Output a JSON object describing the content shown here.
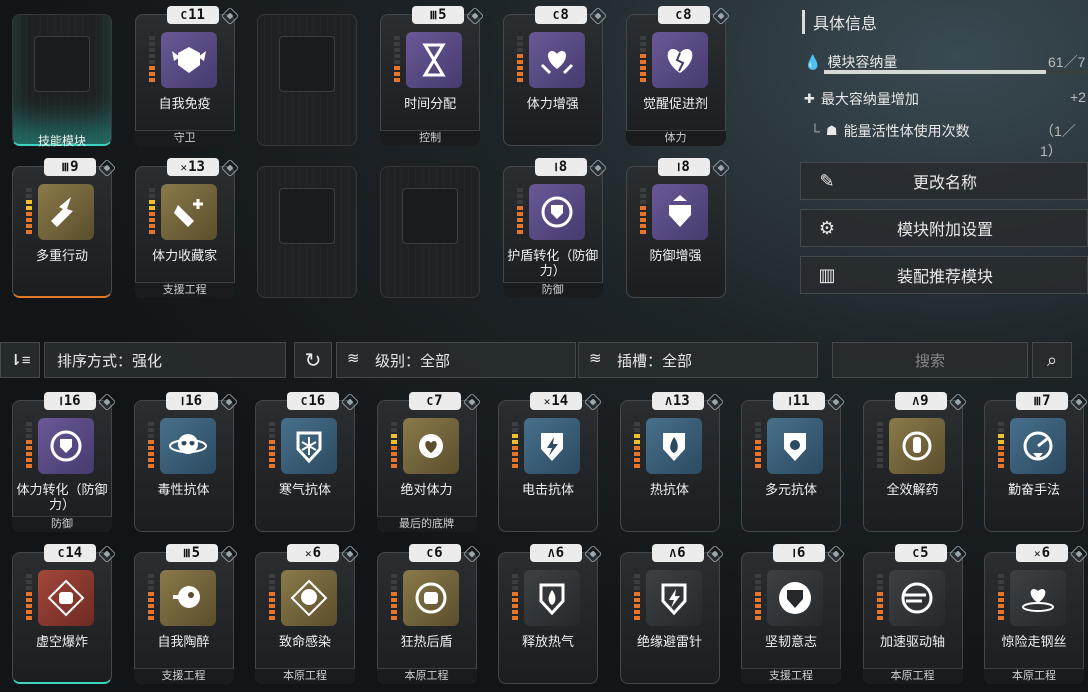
{
  "slots": [
    {
      "key": "s0",
      "tag": "",
      "name": "技能模块",
      "sub": "",
      "empty": true,
      "glow": "teal"
    },
    {
      "key": "s1",
      "tag": "11",
      "tagicon": "C",
      "name": "自我免疫",
      "sub": "守卫",
      "color": "c-purple",
      "bars": 3,
      "icon": "wings-shield-icon"
    },
    {
      "key": "s2",
      "empty": true
    },
    {
      "key": "s3",
      "tag": "5",
      "tagicon": "W",
      "name": "时间分配",
      "sub": "控制",
      "color": "c-purple",
      "bars": 3,
      "icon": "hourglass-icon"
    },
    {
      "key": "s4",
      "tag": "8",
      "tagicon": "C",
      "name": "体力增强",
      "sub": "",
      "color": "c-purple",
      "bars": 5,
      "icon": "heart-hands-icon"
    },
    {
      "key": "s5",
      "tag": "8",
      "tagicon": "C",
      "name": "觉醒促进剂",
      "sub": "体力",
      "color": "c-purple",
      "bars": 5,
      "icon": "broken-heart-icon"
    },
    {
      "key": "s6",
      "tag": "9",
      "tagicon": "W",
      "name": "多重行动",
      "sub": "",
      "color": "c-gold",
      "bars": 6,
      "yellow": true,
      "icon": "lightning-runner-icon",
      "glow": "orange"
    },
    {
      "key": "s7",
      "tag": "13",
      "tagicon": "X",
      "name": "体力收藏家",
      "sub": "支援工程",
      "color": "c-gold",
      "bars": 6,
      "yellow": true,
      "icon": "hand-plus-icon"
    },
    {
      "key": "s8",
      "empty": true
    },
    {
      "key": "s9",
      "empty": true
    },
    {
      "key": "s10",
      "tag": "8",
      "tagicon": "I",
      "name": "护盾转化（防御力）",
      "sub": "防御",
      "color": "c-purple",
      "bars": 5,
      "icon": "shield-cycle-icon"
    },
    {
      "key": "s11",
      "tag": "8",
      "tagicon": "I",
      "name": "防御增强",
      "sub": "",
      "color": "c-purple",
      "bars": 5,
      "icon": "shield-up-icon"
    }
  ],
  "panel": {
    "title": "具体信息",
    "capacity_label": "模块容纳量",
    "capacity_value": "61／7",
    "capacity_fraction": 0.84,
    "max_label": "最大容纳量增加",
    "max_value": "+2",
    "energy_label": "能量活性体使用次数",
    "energy_value": "（1／1）",
    "btn_rename": "更改名称",
    "btn_extra": "模块附加设置",
    "btn_recommend": "装配推荐模块"
  },
  "filters": {
    "sort": "排序方式：强化",
    "level": "级别：全部",
    "slot": "插槽：全部",
    "search_placeholder": "搜索"
  },
  "inventory": [
    {
      "tag": "16",
      "tagicon": "I",
      "name": "体力转化（防御力）",
      "sub": "防御",
      "color": "c-purple",
      "bars": 5,
      "icon": "shield-cycle-icon"
    },
    {
      "tag": "16",
      "tagicon": "I",
      "name": "毒性抗体",
      "sub": "",
      "color": "c-blue",
      "bars": 5,
      "icon": "toxic-skull-icon"
    },
    {
      "tag": "16",
      "tagicon": "C",
      "name": "寒气抗体",
      "sub": "",
      "color": "c-blue",
      "bars": 5,
      "icon": "snowflake-shield-icon"
    },
    {
      "tag": "7",
      "tagicon": "C",
      "name": "绝对体力",
      "sub": "最后的底牌",
      "color": "c-gold",
      "bars": 6,
      "yellow": true,
      "icon": "sun-heart-icon"
    },
    {
      "tag": "14",
      "tagicon": "X",
      "name": "电击抗体",
      "sub": "",
      "color": "c-blue",
      "bars": 6,
      "yellow": true,
      "icon": "bolt-shield-icon"
    },
    {
      "tag": "13",
      "tagicon": "A",
      "name": "热抗体",
      "sub": "",
      "color": "c-blue",
      "bars": 6,
      "yellow": true,
      "icon": "fire-shield-icon"
    },
    {
      "tag": "11",
      "tagicon": "I",
      "name": "多元抗体",
      "sub": "",
      "color": "c-blue",
      "bars": 5,
      "icon": "multi-shield-icon"
    },
    {
      "tag": "9",
      "tagicon": "A",
      "name": "全效解药",
      "sub": "",
      "color": "c-gold",
      "bars": 0,
      "icon": "antidote-icon"
    },
    {
      "tag": "7",
      "tagicon": "W",
      "name": "勤奋手法",
      "sub": "",
      "color": "c-blue",
      "bars": 6,
      "yellow": true,
      "icon": "gauge-icon"
    },
    {
      "tag": "14",
      "tagicon": "C",
      "name": "虚空爆炸",
      "sub": "",
      "color": "c-red",
      "bars": 5,
      "icon": "fist-burst-icon",
      "glow": "teal"
    },
    {
      "tag": "5",
      "tagicon": "W",
      "name": "自我陶醉",
      "sub": "支援工程",
      "color": "c-gold",
      "bars": 5,
      "icon": "head-gun-icon"
    },
    {
      "tag": "6",
      "tagicon": "X",
      "name": "致命感染",
      "sub": "本原工程",
      "color": "c-gold",
      "bars": 5,
      "icon": "skull-burst-icon"
    },
    {
      "tag": "6",
      "tagicon": "C",
      "name": "狂热后盾",
      "sub": "本原工程",
      "color": "c-gold",
      "bars": 5,
      "icon": "fist-circle-icon"
    },
    {
      "tag": "6",
      "tagicon": "A",
      "name": "释放热气",
      "sub": "",
      "color": "c-dark",
      "bars": 5,
      "icon": "fire-emblem-icon"
    },
    {
      "tag": "6",
      "tagicon": "A",
      "name": "绝缘避雷针",
      "sub": "",
      "color": "c-dark",
      "bars": 5,
      "icon": "bolt-emblem-icon"
    },
    {
      "tag": "6",
      "tagicon": "I",
      "name": "坚韧意志",
      "sub": "支援工程",
      "color": "c-dark",
      "bars": 5,
      "icon": "shield-emblem-icon"
    },
    {
      "tag": "5",
      "tagicon": "C",
      "name": "加速驱动轴",
      "sub": "本原工程",
      "color": "c-dark",
      "bars": 5,
      "icon": "gear-speed-icon"
    },
    {
      "tag": "6",
      "tagicon": "X",
      "name": "惊险走钢丝",
      "sub": "本原工程",
      "color": "c-dark",
      "bars": 5,
      "icon": "heart-rope-icon"
    }
  ]
}
